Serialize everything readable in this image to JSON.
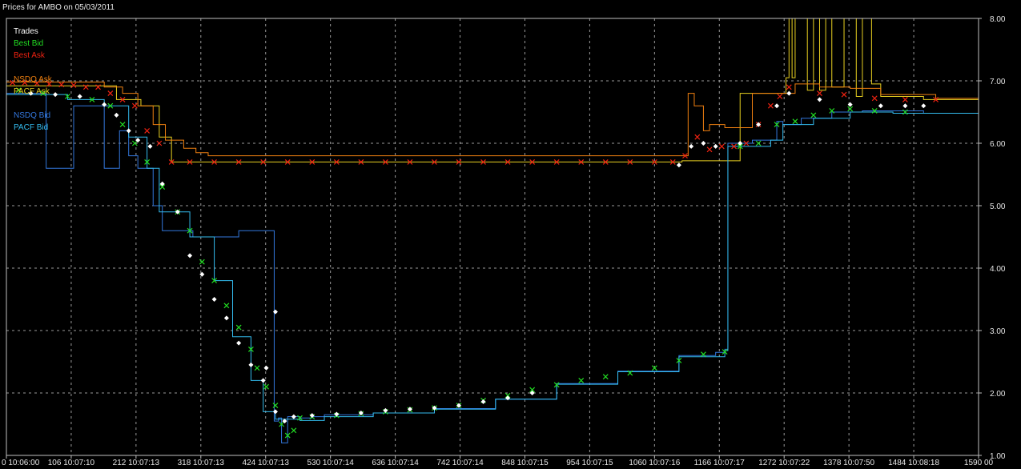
{
  "window": {
    "title": "Prices for AMBO on 05/03/2011"
  },
  "colors": {
    "background": "#000000",
    "grid": "#9a9a9a",
    "axis_text": "#e6e6e6",
    "trades": "#ffffff",
    "best_bid": "#22dd22",
    "best_ask": "#ee2211",
    "nsdq_ask": "#f08010",
    "pacf_ask": "#e8d020",
    "nsdq_bid": "#3377dd",
    "pacf_bid": "#33bbee"
  },
  "chart_data": {
    "type": "line",
    "title": "Prices for AMBO on 05/03/2011",
    "xlabel": "",
    "ylabel": "",
    "xlim": [
      0,
      1590
    ],
    "ylim": [
      1.0,
      8.0
    ],
    "grid": true,
    "legend_position": "top-left",
    "x_ticks": [
      {
        "v": 0,
        "label": "0 10:06:00"
      },
      {
        "v": 106,
        "label": "106 10:07:10"
      },
      {
        "v": 212,
        "label": "212 10:07:13"
      },
      {
        "v": 318,
        "label": "318 10:07:13"
      },
      {
        "v": 424,
        "label": "424 10:07:13"
      },
      {
        "v": 530,
        "label": "530 10:07:14"
      },
      {
        "v": 636,
        "label": "636 10:07:14"
      },
      {
        "v": 742,
        "label": "742 10:07:14"
      },
      {
        "v": 848,
        "label": "848 10:07:15"
      },
      {
        "v": 954,
        "label": "954 10:07:15"
      },
      {
        "v": 1060,
        "label": "1060 10:07:16"
      },
      {
        "v": 1166,
        "label": "1166 10:07:17"
      },
      {
        "v": 1272,
        "label": "1272 10:07:22"
      },
      {
        "v": 1378,
        "label": "1378 10:07:50"
      },
      {
        "v": 1484,
        "label": "1484 10:08:18"
      },
      {
        "v": 1590,
        "label": "1590 00"
      }
    ],
    "y_ticks": [
      {
        "v": 8,
        "label": "8.00"
      },
      {
        "v": 7,
        "label": "7.00"
      },
      {
        "v": 6,
        "label": "6.00"
      },
      {
        "v": 5,
        "label": "5.00"
      },
      {
        "v": 4,
        "label": "4.00"
      },
      {
        "v": 3,
        "label": "3.00"
      },
      {
        "v": 2,
        "label": "2.00"
      },
      {
        "v": 1,
        "label": "1.00"
      }
    ],
    "legend": [
      {
        "key": "trades",
        "label": "Trades"
      },
      {
        "key": "best_bid",
        "label": "Best Bid"
      },
      {
        "key": "best_ask",
        "label": "Best Ask"
      },
      {
        "key": "nsdq_ask",
        "label": "NSDQ Ask"
      },
      {
        "key": "pacf_ask",
        "label": "PACF Ask"
      },
      {
        "key": "nsdq_bid",
        "label": "NSDQ Bid"
      },
      {
        "key": "pacf_bid",
        "label": "PACF Bid"
      }
    ],
    "series": [
      {
        "key": "pacf_ask",
        "name": "PACF Ask",
        "kind": "step",
        "points": [
          [
            0,
            6.92
          ],
          [
            160,
            6.92
          ],
          [
            180,
            6.7
          ],
          [
            220,
            6.6
          ],
          [
            250,
            6.1
          ],
          [
            260,
            6.1
          ],
          [
            270,
            5.7
          ],
          [
            1095,
            5.7
          ],
          [
            1105,
            5.72
          ],
          [
            1190,
            5.72
          ],
          [
            1200,
            6.8
          ],
          [
            1265,
            6.8
          ],
          [
            1275,
            7.05
          ],
          [
            1280,
            8.0
          ],
          [
            1285,
            7.05
          ],
          [
            1290,
            8.0
          ],
          [
            1300,
            8.0
          ],
          [
            1310,
            6.85
          ],
          [
            1320,
            8.0
          ],
          [
            1330,
            6.85
          ],
          [
            1340,
            8.0
          ],
          [
            1350,
            6.9
          ],
          [
            1370,
            8.0
          ],
          [
            1385,
            8.0
          ],
          [
            1390,
            6.75
          ],
          [
            1400,
            8.0
          ],
          [
            1412,
            8.0
          ],
          [
            1415,
            6.95
          ],
          [
            1430,
            6.75
          ],
          [
            1500,
            6.7
          ],
          [
            1590,
            6.7
          ]
        ]
      },
      {
        "key": "nsdq_ask",
        "name": "NSDQ Ask",
        "kind": "step",
        "points": [
          [
            0,
            6.98
          ],
          [
            150,
            6.98
          ],
          [
            160,
            6.9
          ],
          [
            190,
            6.8
          ],
          [
            215,
            6.6
          ],
          [
            240,
            6.3
          ],
          [
            260,
            6.05
          ],
          [
            290,
            5.92
          ],
          [
            310,
            5.85
          ],
          [
            330,
            5.8
          ],
          [
            1100,
            5.8
          ],
          [
            1115,
            6.8
          ],
          [
            1125,
            6.6
          ],
          [
            1140,
            6.2
          ],
          [
            1150,
            6.3
          ],
          [
            1175,
            6.25
          ],
          [
            1220,
            6.8
          ],
          [
            1260,
            6.8
          ],
          [
            1290,
            6.95
          ],
          [
            1330,
            6.9
          ],
          [
            1380,
            6.88
          ],
          [
            1430,
            6.78
          ],
          [
            1520,
            6.72
          ],
          [
            1590,
            6.72
          ]
        ]
      },
      {
        "key": "nsdq_bid",
        "name": "NSDQ Bid",
        "kind": "step",
        "points": [
          [
            0,
            6.8
          ],
          [
            60,
            6.8
          ],
          [
            65,
            5.6
          ],
          [
            100,
            5.6
          ],
          [
            110,
            6.6
          ],
          [
            150,
            6.6
          ],
          [
            160,
            5.6
          ],
          [
            185,
            6.2
          ],
          [
            200,
            5.8
          ],
          [
            215,
            5.6
          ],
          [
            240,
            5.0
          ],
          [
            255,
            4.6
          ],
          [
            300,
            4.6
          ],
          [
            305,
            4.5
          ],
          [
            370,
            4.5
          ],
          [
            380,
            4.6
          ],
          [
            435,
            4.6
          ],
          [
            438,
            1.55
          ],
          [
            445,
            1.6
          ],
          [
            450,
            1.2
          ],
          [
            460,
            1.62
          ],
          [
            480,
            1.6
          ],
          [
            500,
            1.62
          ],
          [
            520,
            1.65
          ],
          [
            600,
            1.68
          ],
          [
            700,
            1.75
          ],
          [
            800,
            1.9
          ],
          [
            900,
            2.15
          ],
          [
            1000,
            2.35
          ],
          [
            1100,
            2.6
          ],
          [
            1160,
            2.65
          ],
          [
            1175,
            2.7
          ],
          [
            1180,
            6.0
          ],
          [
            1200,
            6.0
          ],
          [
            1220,
            6.05
          ],
          [
            1260,
            6.35
          ],
          [
            1270,
            6.3
          ],
          [
            1300,
            6.4
          ],
          [
            1350,
            6.5
          ],
          [
            1400,
            6.52
          ],
          [
            1500,
            6.48
          ],
          [
            1590,
            6.48
          ]
        ]
      },
      {
        "key": "pacf_bid",
        "name": "PACF Bid",
        "kind": "step",
        "points": [
          [
            0,
            6.78
          ],
          [
            100,
            6.7
          ],
          [
            160,
            6.6
          ],
          [
            200,
            6.1
          ],
          [
            230,
            5.6
          ],
          [
            250,
            4.9
          ],
          [
            300,
            4.5
          ],
          [
            340,
            3.8
          ],
          [
            370,
            2.9
          ],
          [
            400,
            2.2
          ],
          [
            420,
            1.7
          ],
          [
            440,
            1.58
          ],
          [
            480,
            1.56
          ],
          [
            520,
            1.62
          ],
          [
            600,
            1.68
          ],
          [
            700,
            1.74
          ],
          [
            800,
            1.9
          ],
          [
            900,
            2.14
          ],
          [
            1000,
            2.34
          ],
          [
            1100,
            2.58
          ],
          [
            1175,
            2.68
          ],
          [
            1180,
            5.95
          ],
          [
            1250,
            6.05
          ],
          [
            1270,
            6.3
          ],
          [
            1320,
            6.4
          ],
          [
            1380,
            6.5
          ],
          [
            1450,
            6.48
          ],
          [
            1590,
            6.48
          ]
        ]
      },
      {
        "key": "best_ask",
        "name": "Best Ask",
        "kind": "markers",
        "marker": "x",
        "points": [
          [
            10,
            6.97
          ],
          [
            30,
            6.97
          ],
          [
            50,
            6.96
          ],
          [
            70,
            6.95
          ],
          [
            90,
            6.94
          ],
          [
            110,
            6.93
          ],
          [
            130,
            6.9
          ],
          [
            150,
            6.9
          ],
          [
            170,
            6.8
          ],
          [
            190,
            6.7
          ],
          [
            210,
            6.6
          ],
          [
            230,
            6.2
          ],
          [
            250,
            6.0
          ],
          [
            270,
            5.7
          ],
          [
            300,
            5.7
          ],
          [
            340,
            5.7
          ],
          [
            380,
            5.7
          ],
          [
            420,
            5.7
          ],
          [
            460,
            5.7
          ],
          [
            500,
            5.7
          ],
          [
            540,
            5.7
          ],
          [
            580,
            5.7
          ],
          [
            620,
            5.7
          ],
          [
            660,
            5.7
          ],
          [
            700,
            5.7
          ],
          [
            740,
            5.7
          ],
          [
            780,
            5.7
          ],
          [
            820,
            5.7
          ],
          [
            860,
            5.7
          ],
          [
            900,
            5.7
          ],
          [
            940,
            5.7
          ],
          [
            980,
            5.7
          ],
          [
            1020,
            5.7
          ],
          [
            1060,
            5.7
          ],
          [
            1090,
            5.7
          ],
          [
            1110,
            5.8
          ],
          [
            1130,
            6.1
          ],
          [
            1150,
            5.9
          ],
          [
            1170,
            5.95
          ],
          [
            1190,
            5.95
          ],
          [
            1210,
            6.0
          ],
          [
            1230,
            6.3
          ],
          [
            1250,
            6.6
          ],
          [
            1265,
            6.75
          ],
          [
            1280,
            6.9
          ],
          [
            1330,
            6.8
          ],
          [
            1370,
            6.78
          ],
          [
            1420,
            6.72
          ],
          [
            1470,
            6.7
          ],
          [
            1520,
            6.7
          ]
        ]
      },
      {
        "key": "best_bid",
        "name": "Best Bid",
        "kind": "markers",
        "marker": "x",
        "points": [
          [
            20,
            6.85
          ],
          [
            60,
            6.8
          ],
          [
            100,
            6.75
          ],
          [
            140,
            6.7
          ],
          [
            170,
            6.6
          ],
          [
            190,
            6.3
          ],
          [
            210,
            6.0
          ],
          [
            230,
            5.7
          ],
          [
            255,
            5.3
          ],
          [
            280,
            4.9
          ],
          [
            300,
            4.6
          ],
          [
            320,
            4.1
          ],
          [
            340,
            3.8
          ],
          [
            360,
            3.4
          ],
          [
            380,
            3.05
          ],
          [
            400,
            2.7
          ],
          [
            410,
            2.4
          ],
          [
            425,
            2.1
          ],
          [
            440,
            1.8
          ],
          [
            450,
            1.5
          ],
          [
            460,
            1.32
          ],
          [
            470,
            1.4
          ],
          [
            480,
            1.6
          ],
          [
            500,
            1.62
          ],
          [
            540,
            1.64
          ],
          [
            580,
            1.67
          ],
          [
            620,
            1.7
          ],
          [
            660,
            1.73
          ],
          [
            700,
            1.76
          ],
          [
            740,
            1.8
          ],
          [
            780,
            1.88
          ],
          [
            820,
            1.96
          ],
          [
            860,
            2.05
          ],
          [
            900,
            2.13
          ],
          [
            940,
            2.2
          ],
          [
            980,
            2.26
          ],
          [
            1020,
            2.32
          ],
          [
            1060,
            2.4
          ],
          [
            1100,
            2.52
          ],
          [
            1140,
            2.62
          ],
          [
            1175,
            2.66
          ],
          [
            1200,
            5.95
          ],
          [
            1230,
            6.0
          ],
          [
            1260,
            6.3
          ],
          [
            1290,
            6.35
          ],
          [
            1320,
            6.45
          ],
          [
            1350,
            6.52
          ],
          [
            1380,
            6.55
          ],
          [
            1420,
            6.52
          ],
          [
            1470,
            6.5
          ]
        ]
      },
      {
        "key": "trades",
        "name": "Trades",
        "kind": "markers",
        "marker": "diamond",
        "points": [
          [
            40,
            6.8
          ],
          [
            80,
            6.78
          ],
          [
            120,
            6.75
          ],
          [
            160,
            6.62
          ],
          [
            180,
            6.45
          ],
          [
            200,
            6.2
          ],
          [
            215,
            6.05
          ],
          [
            235,
            5.95
          ],
          [
            255,
            5.35
          ],
          [
            280,
            4.9
          ],
          [
            300,
            4.2
          ],
          [
            320,
            3.9
          ],
          [
            340,
            3.5
          ],
          [
            360,
            3.2
          ],
          [
            380,
            2.8
          ],
          [
            400,
            2.45
          ],
          [
            420,
            2.2
          ],
          [
            440,
            1.7
          ],
          [
            455,
            1.55
          ],
          [
            470,
            1.62
          ],
          [
            500,
            1.64
          ],
          [
            540,
            1.66
          ],
          [
            580,
            1.68
          ],
          [
            620,
            1.72
          ],
          [
            660,
            1.74
          ],
          [
            700,
            1.76
          ],
          [
            740,
            1.8
          ],
          [
            780,
            1.86
          ],
          [
            820,
            1.92
          ],
          [
            860,
            2.0
          ],
          [
            440,
            3.3
          ],
          [
            425,
            2.4
          ],
          [
            1100,
            5.65
          ],
          [
            1120,
            5.95
          ],
          [
            1140,
            6.0
          ],
          [
            1160,
            5.95
          ],
          [
            1200,
            6.0
          ],
          [
            1230,
            6.3
          ],
          [
            1260,
            6.6
          ],
          [
            1280,
            6.8
          ],
          [
            1330,
            6.7
          ],
          [
            1380,
            6.62
          ],
          [
            1430,
            6.6
          ],
          [
            1470,
            6.6
          ],
          [
            1500,
            6.6
          ]
        ]
      }
    ]
  }
}
